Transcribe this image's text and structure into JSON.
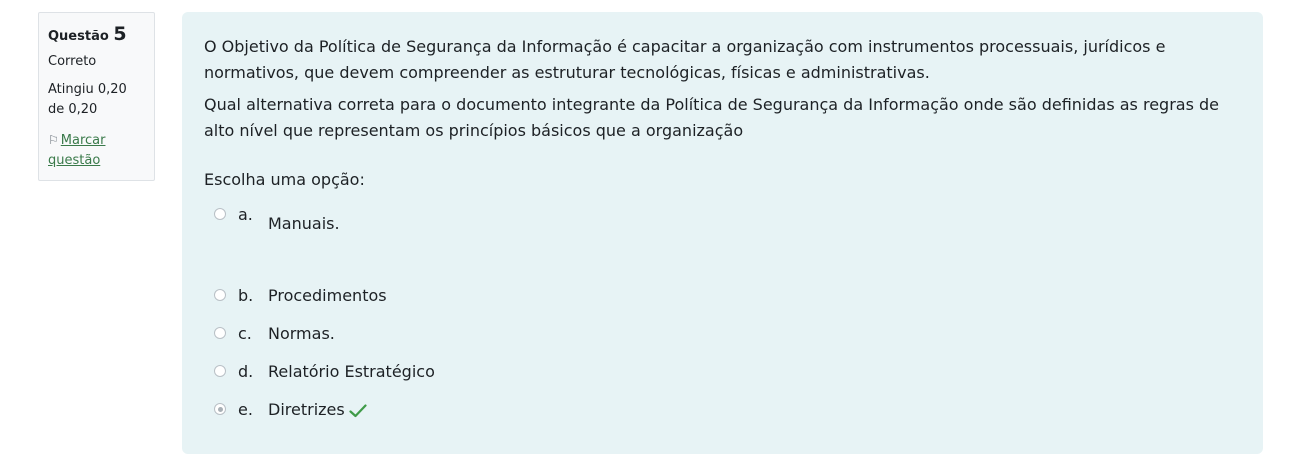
{
  "info": {
    "question_label": "Questão",
    "question_number": "5",
    "state": "Correto",
    "grade": "Atingiu 0,20 de 0,20",
    "flag_label": "Marcar questão"
  },
  "question": {
    "paragraph1": "O Objetivo da Política de Segurança da Informação é capacitar a organização com instrumentos processuais, jurídicos e normativos, que devem compreender as estruturar tecnológicas, físicas e administrativas.",
    "paragraph2": "Qual alternativa correta para o documento integrante da Política de Segurança da Informação onde são definidas as regras de alto nível que representam os princípios básicos que a organização",
    "prompt": "Escolha uma opção:"
  },
  "answers": [
    {
      "letter": "a.",
      "text": "Manuais.",
      "selected": false,
      "correct": false
    },
    {
      "letter": "b.",
      "text": "Procedimentos",
      "selected": false,
      "correct": false
    },
    {
      "letter": "c.",
      "text": "Normas.",
      "selected": false,
      "correct": false
    },
    {
      "letter": "d.",
      "text": "Relatório Estratégico",
      "selected": false,
      "correct": false
    },
    {
      "letter": "e.",
      "text": "Diretrizes",
      "selected": true,
      "correct": true
    }
  ],
  "colors": {
    "content_bg": "#e7f3f5",
    "info_bg": "#f8f9fa",
    "correct_check": "#3f9b48",
    "link": "#3a7a4a"
  },
  "icons": {
    "flag": "flag-icon",
    "correct": "check-icon"
  }
}
